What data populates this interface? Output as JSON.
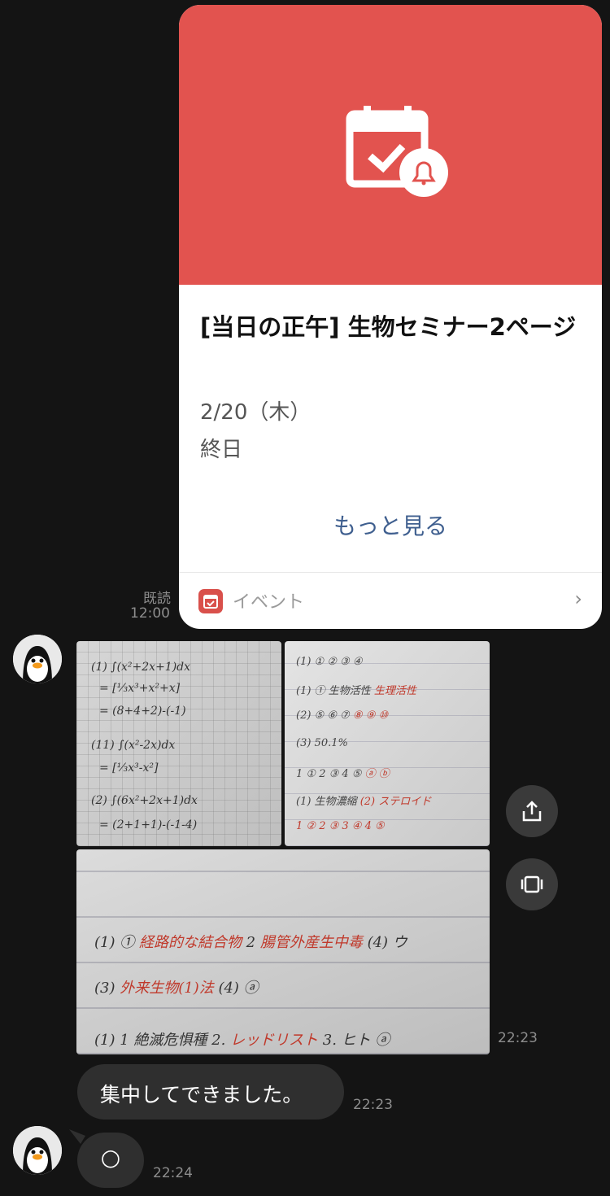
{
  "event_card": {
    "title": "[当日の正午] 生物セミナー2ページ",
    "date": "2/20（木）",
    "all_day": "終日",
    "more_label": "もっと見る",
    "footer_label": "イベント",
    "footer_chevron": "›",
    "hero_color": "#e2534f",
    "icon": "calendar-bell-icon"
  },
  "read_receipt": {
    "label": "既読",
    "time": "12:00"
  },
  "photo_message": {
    "time": "22:23",
    "photos": [
      {
        "name": "math-notes-photo"
      },
      {
        "name": "biology-notes-photo"
      },
      {
        "name": "answer-notes-photo"
      }
    ],
    "side_buttons": [
      "share-icon",
      "collage-icon"
    ]
  },
  "text_message": {
    "text": "集中してできました。",
    "time": "22:23"
  },
  "circle_message": {
    "text": "○",
    "time": "22:24"
  },
  "colors": {
    "background": "#141414",
    "bubble": "#2f2f2f",
    "link": "#3f5f8f",
    "accent_red": "#e2534f"
  }
}
